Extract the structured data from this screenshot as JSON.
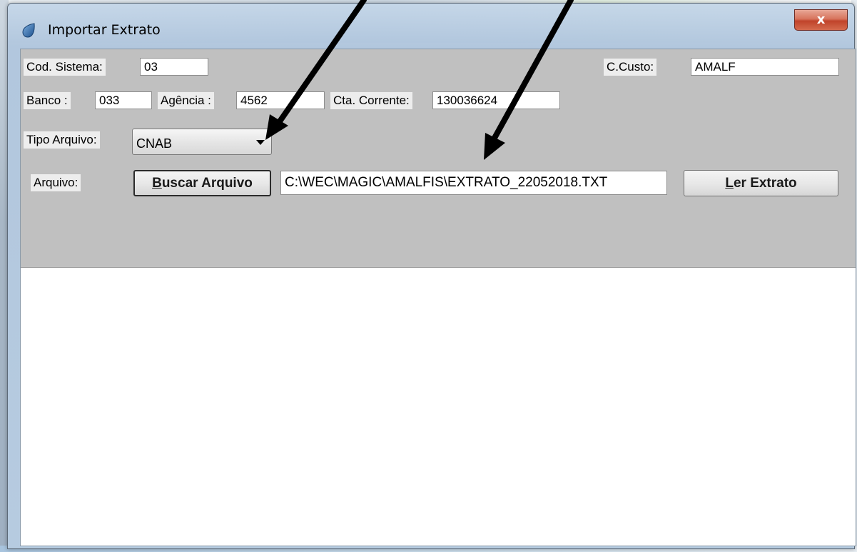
{
  "window": {
    "title": "Importar Extrato",
    "close_label": "x"
  },
  "form": {
    "cod_sistema": {
      "label": "Cod. Sistema:",
      "value": "03"
    },
    "c_custo": {
      "label": "C.Custo:",
      "value": "AMALF"
    },
    "banco": {
      "label": "Banco :",
      "value": "033"
    },
    "agencia": {
      "label": "Agência :",
      "value": "4562"
    },
    "cta_corrente": {
      "label": "Cta. Corrente:",
      "value": "130036624"
    },
    "tipo_arquivo": {
      "label": "Tipo Arquivo:",
      "selected": "CNAB"
    },
    "arquivo": {
      "label": "Arquivo:",
      "path": "C:\\WEC\\MAGIC\\AMALFIS\\EXTRATO_22052018.TXT"
    },
    "buscar_button": {
      "accel": "B",
      "rest": "uscar Arquivo"
    },
    "ler_button": {
      "accel": "L",
      "rest": "er Extrato"
    }
  },
  "colors": {
    "panel": "#c0c0c0",
    "label_bg": "#ededed",
    "close_red": "#c0432a",
    "annotation_arrow": "#000000"
  },
  "icons": {
    "app": "water-drop-icon",
    "dropdown": "caret-down-icon"
  }
}
